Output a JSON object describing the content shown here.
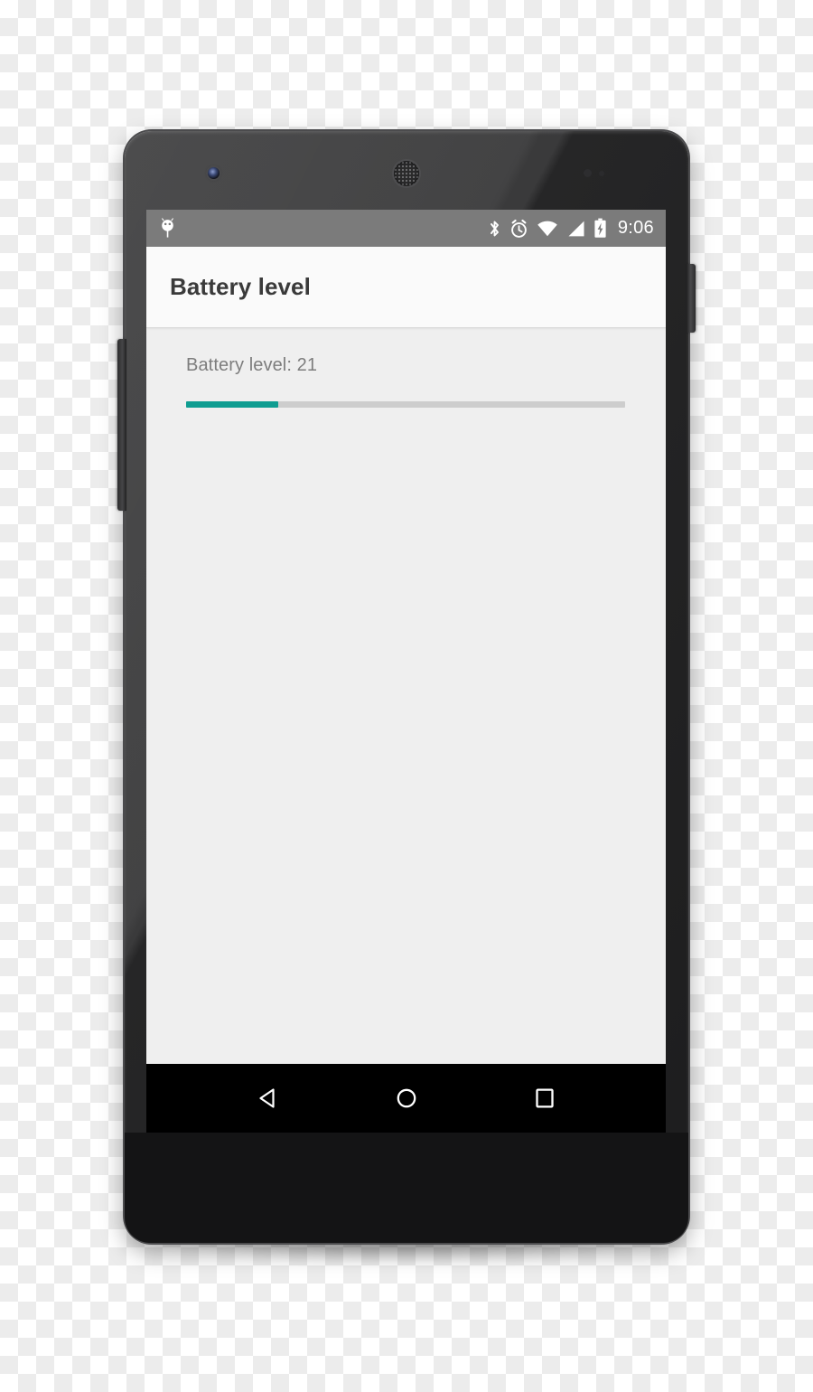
{
  "device": {
    "name": "android-phone-nexus5",
    "hardware": {
      "front_camera": "front-camera",
      "earpiece": "earpiece-speaker",
      "proximity_sensor": "proximity-sensor",
      "volume_button": "volume-rocker",
      "power_button": "power-button"
    }
  },
  "status_bar": {
    "debug_icon": "android-bugdroid-icon",
    "icons": [
      {
        "name": "bluetooth-icon",
        "label": "Bluetooth"
      },
      {
        "name": "alarm-icon",
        "label": "Alarm set"
      },
      {
        "name": "wifi-icon",
        "label": "Wi-Fi"
      },
      {
        "name": "cellular-signal-icon",
        "label": "Cellular signal"
      },
      {
        "name": "battery-charging-icon",
        "label": "Charging"
      }
    ],
    "clock": "9:06",
    "background_color": "#7b7b7b",
    "foreground_color": "#ffffff"
  },
  "action_bar": {
    "title": "Battery level",
    "background_color": "#fafafa",
    "title_color": "#3a3a3a"
  },
  "content": {
    "battery_label": "Battery level: 21",
    "progress": {
      "value": 21,
      "max": 100,
      "percent_text": "21%",
      "fill_color": "#0f9d91",
      "track_color": "#cdcdcd"
    },
    "background_color": "#efefef"
  },
  "nav_bar": {
    "background_color": "#000000",
    "buttons": [
      {
        "name": "nav-back-button",
        "label": "Back"
      },
      {
        "name": "nav-home-button",
        "label": "Home"
      },
      {
        "name": "nav-recents-button",
        "label": "Recents"
      }
    ]
  }
}
